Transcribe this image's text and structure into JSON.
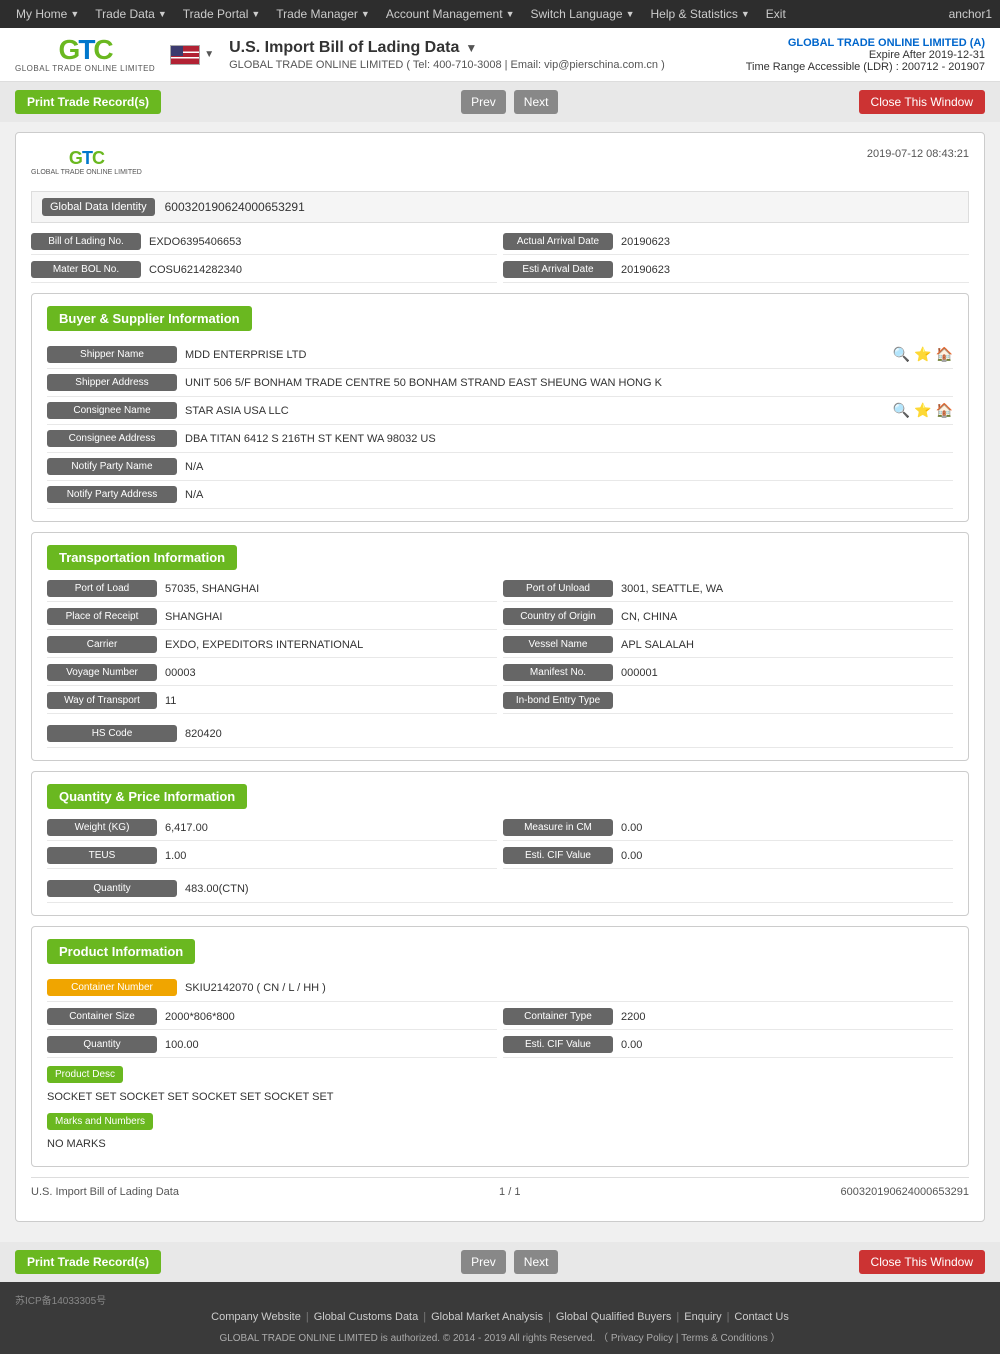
{
  "topnav": {
    "items": [
      "My Home",
      "Trade Data",
      "Trade Portal",
      "Trade Manager",
      "Account Management",
      "Switch Language",
      "Help & Statistics",
      "Exit"
    ],
    "anchor": "anchor1"
  },
  "header": {
    "title": "U.S. Import Bill of Lading Data",
    "subtitle": "GLOBAL TRADE ONLINE LIMITED ( Tel: 400-710-3008 | Email: vip@pierschina.com.cn )",
    "company": "GLOBAL TRADE ONLINE LIMITED (A)",
    "expire": "Expire After 2019-12-31",
    "ldr": "Time Range Accessible (LDR) : 200712 - 201907"
  },
  "toolbar": {
    "print_label": "Print Trade Record(s)",
    "prev_label": "Prev",
    "next_label": "Next",
    "close_label": "Close This Window"
  },
  "record": {
    "date": "2019-07-12 08:43:21",
    "global_data_identity_label": "Global Data Identity",
    "global_data_identity_value": "600320190624000653291",
    "bol_no_label": "Bill of Lading No.",
    "bol_no_value": "EXDO6395406653",
    "actual_arrival_label": "Actual Arrival Date",
    "actual_arrival_value": "20190623",
    "master_bol_label": "Mater BOL No.",
    "master_bol_value": "COSU6214282340",
    "esti_arrival_label": "Esti Arrival Date",
    "esti_arrival_value": "20190623"
  },
  "buyer_supplier": {
    "section_title": "Buyer & Supplier Information",
    "shipper_name_label": "Shipper Name",
    "shipper_name_value": "MDD ENTERPRISE LTD",
    "shipper_addr_label": "Shipper Address",
    "shipper_addr_value": "UNIT 506 5/F BONHAM TRADE CENTRE 50 BONHAM STRAND EAST SHEUNG WAN HONG K",
    "consignee_name_label": "Consignee Name",
    "consignee_name_value": "STAR ASIA USA LLC",
    "consignee_addr_label": "Consignee Address",
    "consignee_addr_value": "DBA TITAN 6412 S 216TH ST KENT WA 98032 US",
    "notify_party_label": "Notify Party Name",
    "notify_party_value": "N/A",
    "notify_party_addr_label": "Notify Party Address",
    "notify_party_addr_value": "N/A"
  },
  "transportation": {
    "section_title": "Transportation Information",
    "port_load_label": "Port of Load",
    "port_load_value": "57035, SHANGHAI",
    "port_unload_label": "Port of Unload",
    "port_unload_value": "3001, SEATTLE, WA",
    "place_receipt_label": "Place of Receipt",
    "place_receipt_value": "SHANGHAI",
    "country_origin_label": "Country of Origin",
    "country_origin_value": "CN, CHINA",
    "carrier_label": "Carrier",
    "carrier_value": "EXDO, EXPEDITORS INTERNATIONAL",
    "vessel_name_label": "Vessel Name",
    "vessel_name_value": "APL SALALAH",
    "voyage_number_label": "Voyage Number",
    "voyage_number_value": "00003",
    "manifest_label": "Manifest No.",
    "manifest_value": "000001",
    "way_transport_label": "Way of Transport",
    "way_transport_value": "11",
    "inbond_label": "In-bond Entry Type",
    "inbond_value": "",
    "hs_code_label": "HS Code",
    "hs_code_value": "820420"
  },
  "quantity_price": {
    "section_title": "Quantity & Price Information",
    "weight_label": "Weight (KG)",
    "weight_value": "6,417.00",
    "measure_label": "Measure in CM",
    "measure_value": "0.00",
    "teus_label": "TEUS",
    "teus_value": "1.00",
    "esti_cif_label": "Esti. CIF Value",
    "esti_cif_value": "0.00",
    "quantity_label": "Quantity",
    "quantity_value": "483.00(CTN)"
  },
  "product": {
    "section_title": "Product Information",
    "container_number_label": "Container Number",
    "container_number_value": "SKIU2142070 ( CN / L / HH )",
    "container_size_label": "Container Size",
    "container_size_value": "2000*806*800",
    "container_type_label": "Container Type",
    "container_type_value": "2200",
    "quantity_label": "Quantity",
    "quantity_value": "100.00",
    "esti_cif_label": "Esti. CIF Value",
    "esti_cif_value": "0.00",
    "product_desc_label": "Product Desc",
    "product_desc_value": "SOCKET SET SOCKET SET SOCKET SET SOCKET SET",
    "marks_label": "Marks and Numbers",
    "marks_value": "NO MARKS"
  },
  "footer_record": {
    "left": "U.S. Import Bill of Lading Data",
    "middle": "1 / 1",
    "right": "600320190624000653291"
  },
  "footer": {
    "icp": "苏ICP备14033305号",
    "links": [
      "Company Website",
      "Global Customs Data",
      "Global Market Analysis",
      "Global Qualified Buyers",
      "Enquiry",
      "Contact Us"
    ],
    "copyright": "GLOBAL TRADE ONLINE LIMITED is authorized. © 2014 - 2019 All rights Reserved.  （ Privacy Policy | Terms & Conditions ）"
  }
}
